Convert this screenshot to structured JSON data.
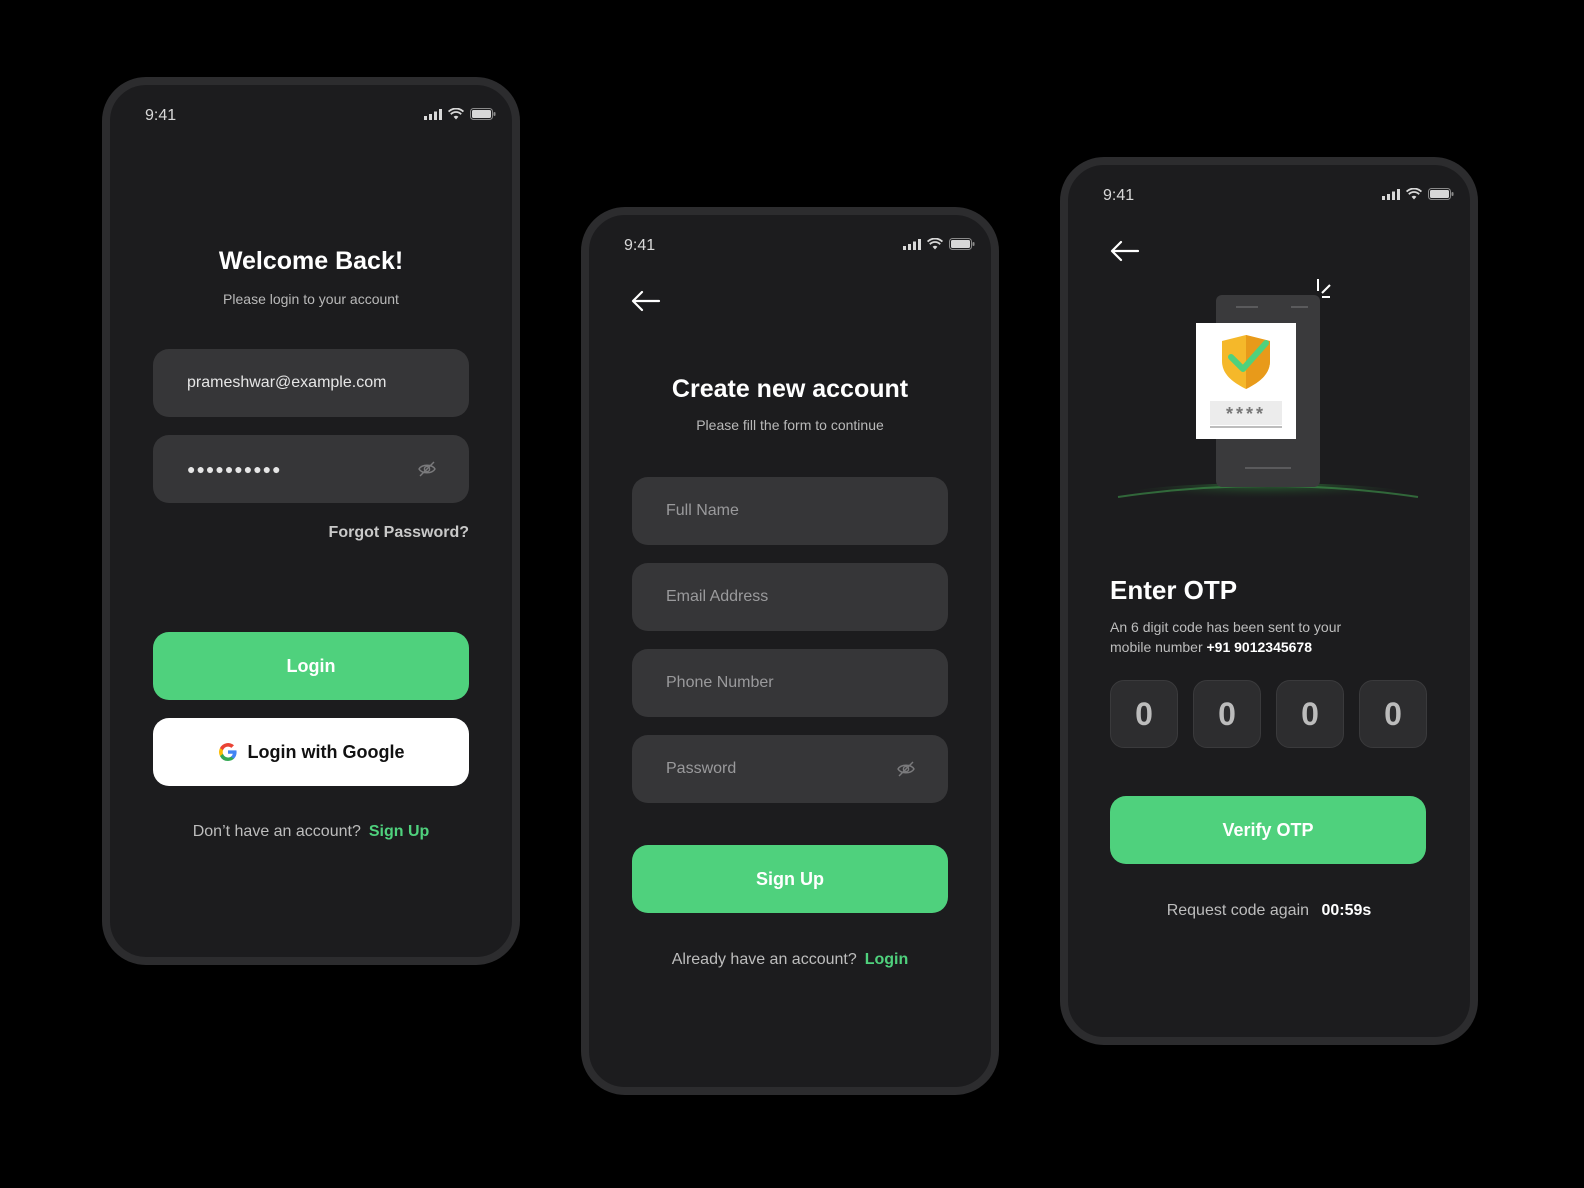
{
  "status_bar": {
    "time": "9:41"
  },
  "login": {
    "title": "Welcome Back!",
    "subtitle": "Please login to  your account",
    "email_value": "prameshwar@example.com",
    "password_value": "●●●●●●●●●●",
    "forgot_password": "Forgot Password?",
    "login_button": "Login",
    "google_button": "Login with Google",
    "footer_text": "Don’t have an account?",
    "footer_link": "Sign Up"
  },
  "signup": {
    "title": "Create new account",
    "subtitle": "Please fill the form to continue",
    "fields": {
      "full_name": "Full Name",
      "email": "Email Address",
      "phone": "Phone Number",
      "password": "Password"
    },
    "signup_button": "Sign Up",
    "footer_text": "Already have an account?",
    "footer_link": "Login"
  },
  "otp": {
    "illustration_code": "****",
    "title": "Enter OTP",
    "description_line1": "An 6 digit code has been sent to your",
    "description_line2": "mobile number",
    "phone_number": "+91 9012345678",
    "digits": [
      "0",
      "0",
      "0",
      "0"
    ],
    "verify_button": "Verify OTP",
    "resend_text": "Request code again",
    "timer": "00:59s"
  },
  "colors": {
    "accent": "#4fd17d",
    "background": "#000000",
    "phone_surface": "#1c1c1e",
    "field": "#363638"
  }
}
